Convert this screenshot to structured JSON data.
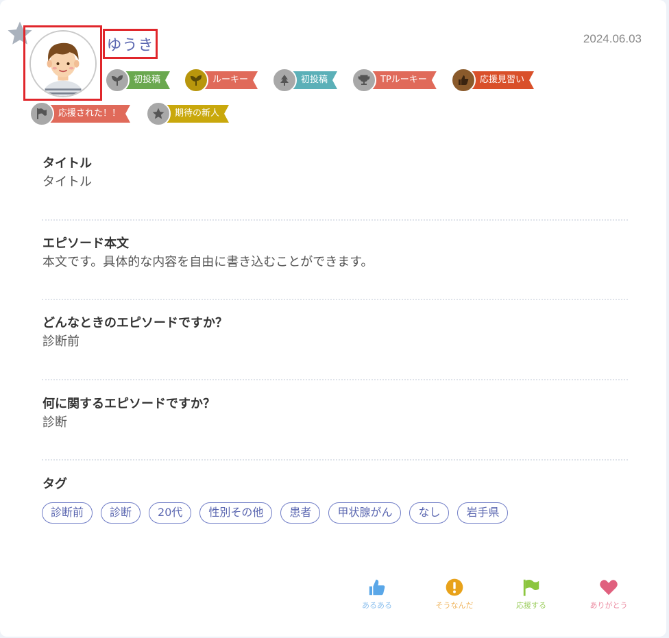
{
  "post": {
    "username": "ゆうき",
    "date": "2024.06.03"
  },
  "badges": [
    {
      "label": "初投稿",
      "icon": "sprout-icon",
      "circle_color": "#a8a8a8",
      "ribbon_color": "#6aa84f"
    },
    {
      "label": "ルーキー",
      "icon": "sprout-icon",
      "circle_color": "#b8960c",
      "ribbon_color": "#e06a5a"
    },
    {
      "label": "初投稿",
      "icon": "tree-icon",
      "circle_color": "#a8a8a8",
      "ribbon_color": "#5bb0b8"
    },
    {
      "label": "TPルーキー",
      "icon": "trophy-icon",
      "circle_color": "#a8a8a8",
      "ribbon_color": "#e06a5a"
    },
    {
      "label": "応援見習い",
      "icon": "thumbs-up-icon",
      "circle_color": "#8a5a2b",
      "ribbon_color": "#d9502a"
    },
    {
      "label": "応援された！！",
      "icon": "flag-icon",
      "circle_color": "#a8a8a8",
      "ribbon_color": "#e06a5a"
    },
    {
      "label": "期待の新人",
      "icon": "star-icon",
      "circle_color": "#a8a8a8",
      "ribbon_color": "#c9a80c"
    }
  ],
  "fields": [
    {
      "title": "タイトル",
      "value": "タイトル"
    },
    {
      "title": "エピソード本文",
      "value": "本文です。具体的な内容を自由に書き込むことができます。"
    },
    {
      "title": "どんなときのエピソードですか？",
      "value": "診断前"
    },
    {
      "title": "何に関するエピソードですか？",
      "value": "診断"
    }
  ],
  "tags_section": {
    "title": "タグ",
    "tags": [
      "診断前",
      "診断",
      "20代",
      "性別その他",
      "患者",
      "甲状腺がん",
      "なし",
      "岩手県"
    ]
  },
  "actions": [
    {
      "label": "あるある",
      "icon": "thumbs-up-icon",
      "color": "#5aa7e8"
    },
    {
      "label": "そうなんだ",
      "icon": "exclamation-icon",
      "color": "#e8a21a"
    },
    {
      "label": "応援する",
      "icon": "flag-icon",
      "color": "#8cc63f"
    },
    {
      "label": "ありがとう",
      "icon": "heart-icon",
      "color": "#e0607e"
    }
  ]
}
